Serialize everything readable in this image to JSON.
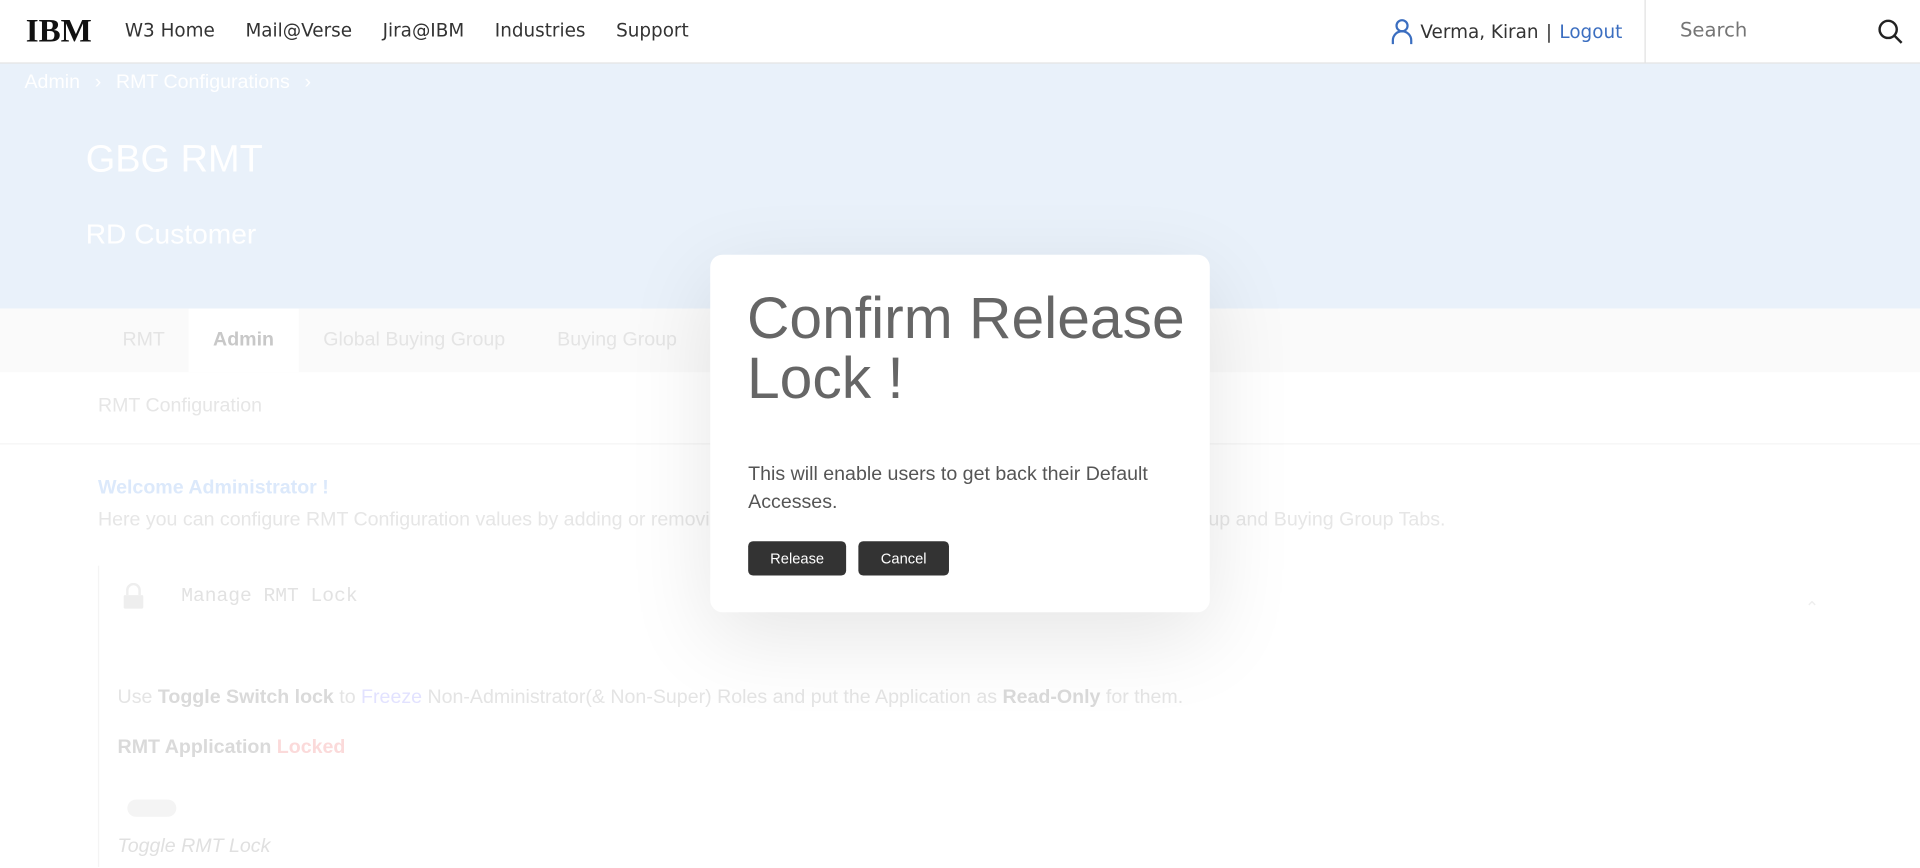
{
  "header": {
    "logo": "IBM",
    "nav": [
      "W3 Home",
      "Mail@Verse",
      "Jira@IBM",
      "Industries",
      "Support"
    ],
    "user_name": "Verma, Kiran",
    "separator": "|",
    "logout": "Logout",
    "search_placeholder": "Search"
  },
  "breadcrumb": [
    "Admin",
    "RMT Configurations"
  ],
  "hero": {
    "title": "GBG RMT",
    "subtitle": "RD Customer"
  },
  "tabs": [
    "RMT",
    "Admin",
    "Global Buying Group",
    "Buying Group"
  ],
  "active_tab": "Admin",
  "subnav": "RMT Configuration",
  "content": {
    "welcome": "Welcome Administrator !",
    "description": "Here you can configure RMT Configuration values by adding or removing values which will be reflected in the Global Buying Group and Buying Group Tabs.",
    "section_title": "Manage RMT Lock",
    "use_1": "Use ",
    "use_b1": "Toggle Switch lock",
    "use_2": " to ",
    "use_freeze": "Freeze",
    "use_3": " Non-Administrator(& Non-Super) Roles and put the Application as ",
    "use_b2": "Read-Only",
    "use_4": " for them.",
    "app_label": "RMT Application ",
    "app_status": "Locked",
    "toggle_label": "Toggle RMT Lock",
    "toggle_on": false
  },
  "modal": {
    "title": "Confirm Release Lock !",
    "body": "This will enable users to get back their Default Accesses.",
    "release": "Release",
    "cancel": "Cancel"
  },
  "colors": {
    "link": "#3b6ec0",
    "hero": "#e9f1fa",
    "button": "#333333"
  }
}
